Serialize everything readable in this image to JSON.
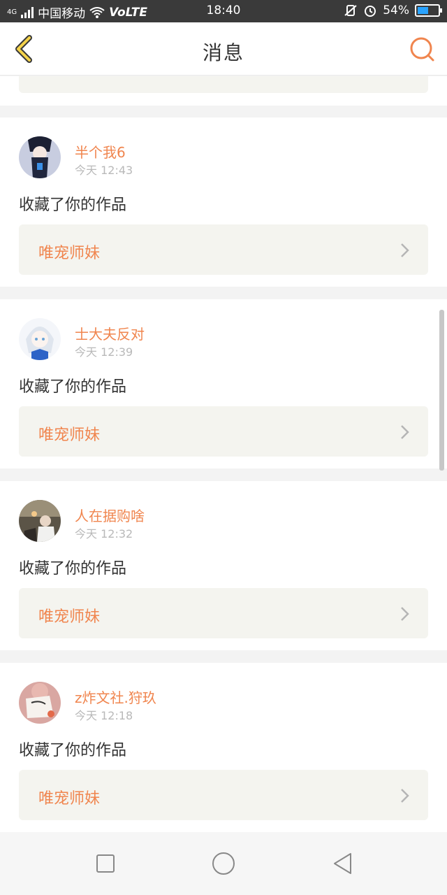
{
  "status_bar": {
    "network": "4G",
    "carrier": "中国移动",
    "volte": "VoLTE",
    "time": "18:40",
    "battery_text": "54%",
    "battery_level": 0.54
  },
  "header": {
    "title": "消息",
    "back_icon": "chevron-left-icon",
    "search_icon": "search-icon",
    "accent_color": "#f0854e"
  },
  "messages": [
    {
      "user": "半个我6",
      "time": "今天 12:43",
      "action": "收藏了你的作品",
      "work_title": "唯宠师妹"
    },
    {
      "user": "士大夫反对",
      "time": "今天 12:39",
      "action": "收藏了你的作品",
      "work_title": "唯宠师妹"
    },
    {
      "user": "人在据购啥",
      "time": "今天 12:32",
      "action": "收藏了你的作品",
      "work_title": "唯宠师妹"
    },
    {
      "user": "z炸文社.狩玖",
      "time": "今天 12:18",
      "action": "收藏了你的作品",
      "work_title": "唯宠师妹"
    }
  ],
  "nav_bar": {
    "recent_icon": "square-icon",
    "home_icon": "circle-icon",
    "back_icon": "triangle-back-icon"
  }
}
